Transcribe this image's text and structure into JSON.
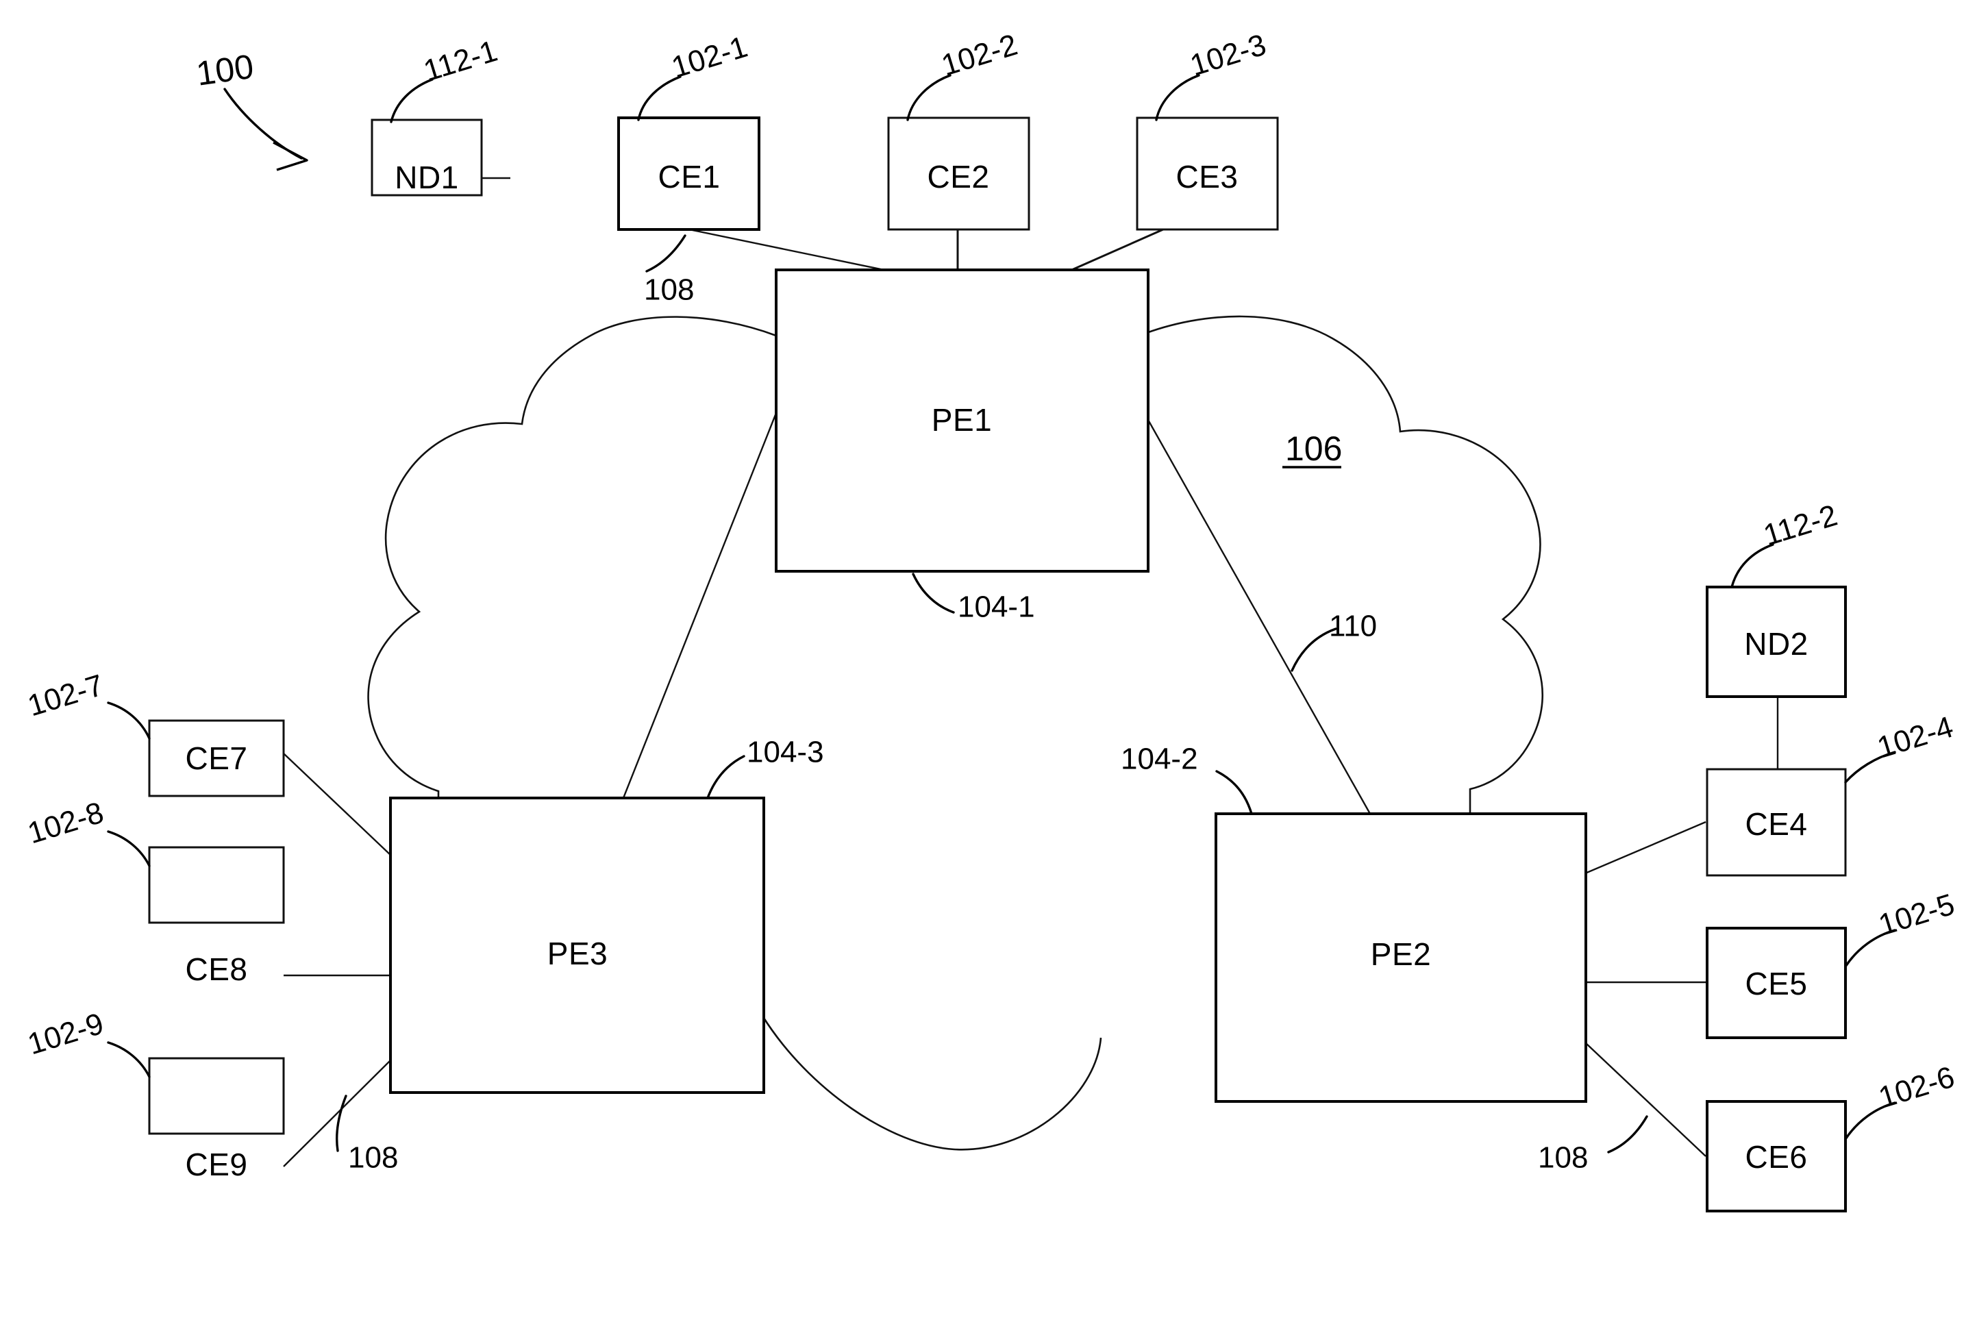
{
  "figure": {
    "number": "100",
    "cloud_label": "106",
    "cloud_label_underlined": true
  },
  "nodes": [
    {
      "id": "nd1",
      "label": "ND1",
      "ref": "112-1"
    },
    {
      "id": "ce1",
      "label": "CE1",
      "ref": "102-1"
    },
    {
      "id": "ce2",
      "label": "CE2",
      "ref": "102-2"
    },
    {
      "id": "ce3",
      "label": "CE3",
      "ref": "102-3"
    },
    {
      "id": "ce4",
      "label": "CE4",
      "ref": "102-4"
    },
    {
      "id": "ce5",
      "label": "CE5",
      "ref": "102-5"
    },
    {
      "id": "ce6",
      "label": "CE6",
      "ref": "102-6"
    },
    {
      "id": "ce7",
      "label": "CE7",
      "ref": "102-7"
    },
    {
      "id": "ce8",
      "label": "CE8",
      "ref": "102-8"
    },
    {
      "id": "ce9",
      "label": "CE9",
      "ref": "102-9"
    },
    {
      "id": "nd2",
      "label": "ND2",
      "ref": "112-2"
    },
    {
      "id": "pe1",
      "label": "PE1",
      "ref": "104-1"
    },
    {
      "id": "pe2",
      "label": "PE2",
      "ref": "104-2"
    },
    {
      "id": "pe3",
      "label": "PE3",
      "ref": "104-3"
    }
  ],
  "link_refs": {
    "attachment_circuit": "108",
    "core_link": "110"
  },
  "ref_callouts": {
    "figure": "100",
    "nd1": "112-1",
    "ce1": "102-1",
    "ce2": "102-2",
    "ce3": "102-3",
    "ce4": "102-4",
    "ce5": "102-5",
    "ce6": "102-6",
    "ce7": "102-7",
    "ce8": "102-8",
    "ce9": "102-9",
    "nd2": "112-2",
    "pe1": "104-1",
    "pe2": "104-2",
    "pe3": "104-3",
    "cloud": "106",
    "ac_top": "108",
    "ac_left": "108",
    "ac_right": "108",
    "core_link": "110"
  },
  "colors": {
    "stroke": "#111111",
    "background": "#ffffff",
    "text": "#000000"
  }
}
